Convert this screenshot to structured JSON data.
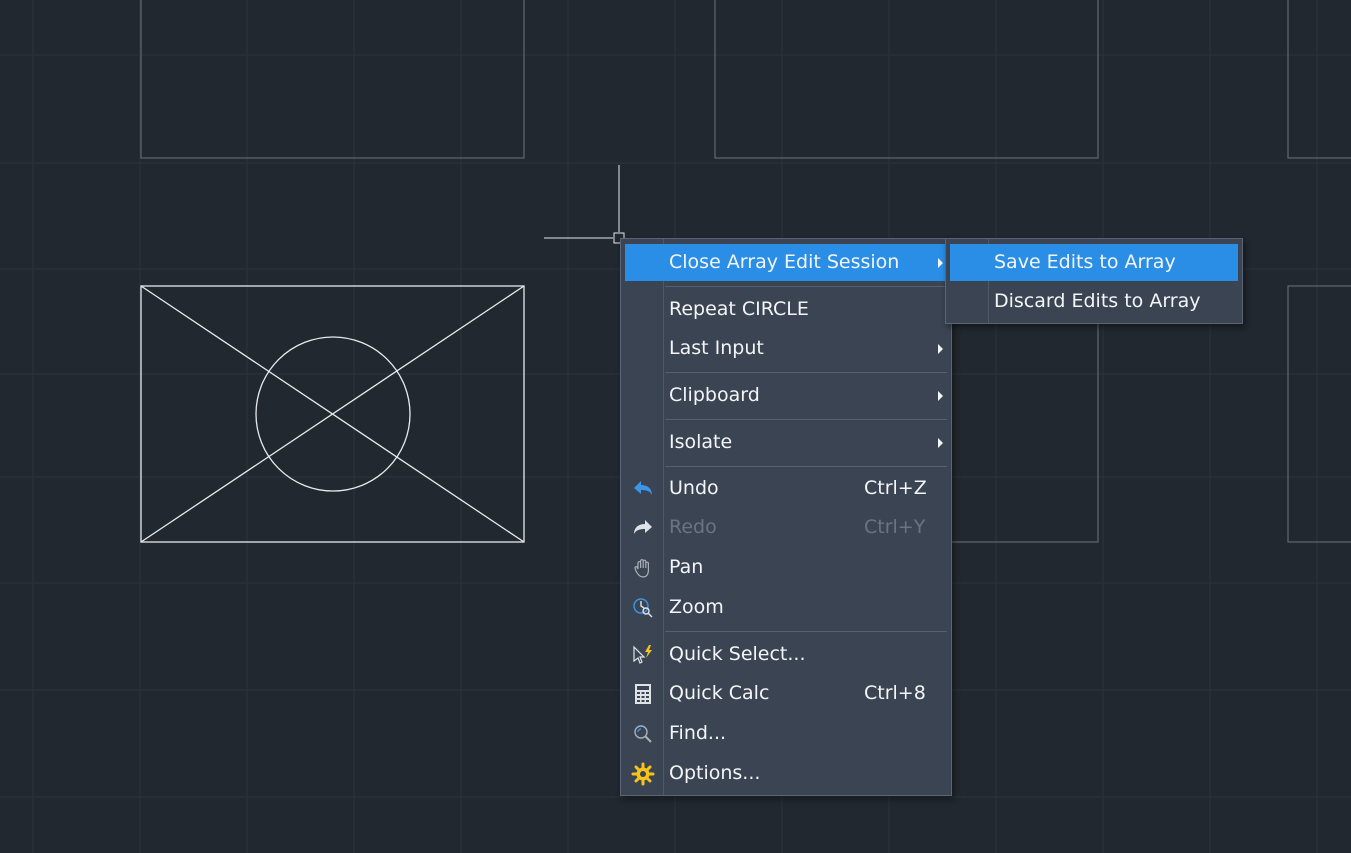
{
  "colors": {
    "canvas_background": "#212830",
    "menu_background": "#3b4452",
    "highlight": "#2a8ee6",
    "disabled_text": "#6b7480",
    "icon_blue": "#3c95e6",
    "icon_yellow": "#f5c31c"
  },
  "context_menu": {
    "items": [
      {
        "label": "Close Array Edit Session",
        "has_submenu": true,
        "highlighted": true
      },
      {
        "label": "Repeat CIRCLE"
      },
      {
        "label": "Last Input",
        "has_submenu": true
      },
      {
        "label": "Clipboard",
        "has_submenu": true
      },
      {
        "label": "Isolate",
        "has_submenu": true
      },
      {
        "label": "Undo",
        "shortcut": "Ctrl+Z",
        "icon": "undo-icon"
      },
      {
        "label": "Redo",
        "shortcut": "Ctrl+Y",
        "icon": "redo-icon",
        "disabled": true
      },
      {
        "label": "Pan",
        "icon": "pan-hand-icon"
      },
      {
        "label": "Zoom",
        "icon": "zoom-icon"
      },
      {
        "label": "Quick Select...",
        "icon": "quick-select-icon"
      },
      {
        "label": "Quick Calc",
        "shortcut": "Ctrl+8",
        "icon": "calculator-icon"
      },
      {
        "label": "Find...",
        "icon": "find-icon"
      },
      {
        "label": "Options...",
        "icon": "options-gear-icon"
      }
    ]
  },
  "submenu": {
    "items": [
      {
        "label": "Save Edits to Array",
        "highlighted": true
      },
      {
        "label": "Discard Edits to Array"
      }
    ]
  }
}
